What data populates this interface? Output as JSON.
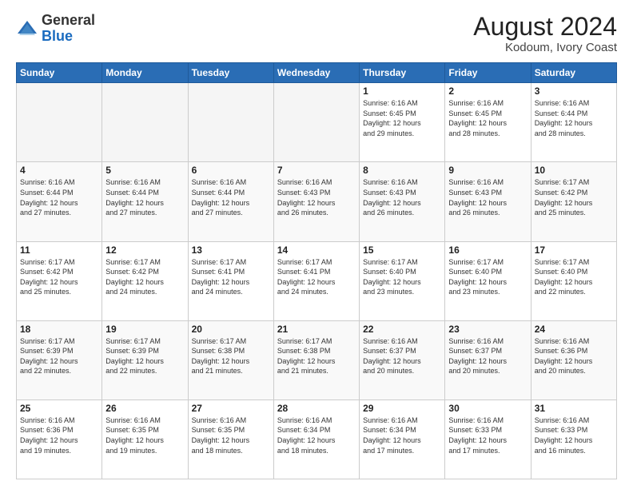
{
  "header": {
    "logo_general": "General",
    "logo_blue": "Blue",
    "month_year": "August 2024",
    "location": "Kodoum, Ivory Coast"
  },
  "days_of_week": [
    "Sunday",
    "Monday",
    "Tuesday",
    "Wednesday",
    "Thursday",
    "Friday",
    "Saturday"
  ],
  "weeks": [
    [
      {
        "day": "",
        "info": ""
      },
      {
        "day": "",
        "info": ""
      },
      {
        "day": "",
        "info": ""
      },
      {
        "day": "",
        "info": ""
      },
      {
        "day": "1",
        "info": "Sunrise: 6:16 AM\nSunset: 6:45 PM\nDaylight: 12 hours\nand 29 minutes."
      },
      {
        "day": "2",
        "info": "Sunrise: 6:16 AM\nSunset: 6:45 PM\nDaylight: 12 hours\nand 28 minutes."
      },
      {
        "day": "3",
        "info": "Sunrise: 6:16 AM\nSunset: 6:44 PM\nDaylight: 12 hours\nand 28 minutes."
      }
    ],
    [
      {
        "day": "4",
        "info": "Sunrise: 6:16 AM\nSunset: 6:44 PM\nDaylight: 12 hours\nand 27 minutes."
      },
      {
        "day": "5",
        "info": "Sunrise: 6:16 AM\nSunset: 6:44 PM\nDaylight: 12 hours\nand 27 minutes."
      },
      {
        "day": "6",
        "info": "Sunrise: 6:16 AM\nSunset: 6:44 PM\nDaylight: 12 hours\nand 27 minutes."
      },
      {
        "day": "7",
        "info": "Sunrise: 6:16 AM\nSunset: 6:43 PM\nDaylight: 12 hours\nand 26 minutes."
      },
      {
        "day": "8",
        "info": "Sunrise: 6:16 AM\nSunset: 6:43 PM\nDaylight: 12 hours\nand 26 minutes."
      },
      {
        "day": "9",
        "info": "Sunrise: 6:16 AM\nSunset: 6:43 PM\nDaylight: 12 hours\nand 26 minutes."
      },
      {
        "day": "10",
        "info": "Sunrise: 6:17 AM\nSunset: 6:42 PM\nDaylight: 12 hours\nand 25 minutes."
      }
    ],
    [
      {
        "day": "11",
        "info": "Sunrise: 6:17 AM\nSunset: 6:42 PM\nDaylight: 12 hours\nand 25 minutes."
      },
      {
        "day": "12",
        "info": "Sunrise: 6:17 AM\nSunset: 6:42 PM\nDaylight: 12 hours\nand 24 minutes."
      },
      {
        "day": "13",
        "info": "Sunrise: 6:17 AM\nSunset: 6:41 PM\nDaylight: 12 hours\nand 24 minutes."
      },
      {
        "day": "14",
        "info": "Sunrise: 6:17 AM\nSunset: 6:41 PM\nDaylight: 12 hours\nand 24 minutes."
      },
      {
        "day": "15",
        "info": "Sunrise: 6:17 AM\nSunset: 6:40 PM\nDaylight: 12 hours\nand 23 minutes."
      },
      {
        "day": "16",
        "info": "Sunrise: 6:17 AM\nSunset: 6:40 PM\nDaylight: 12 hours\nand 23 minutes."
      },
      {
        "day": "17",
        "info": "Sunrise: 6:17 AM\nSunset: 6:40 PM\nDaylight: 12 hours\nand 22 minutes."
      }
    ],
    [
      {
        "day": "18",
        "info": "Sunrise: 6:17 AM\nSunset: 6:39 PM\nDaylight: 12 hours\nand 22 minutes."
      },
      {
        "day": "19",
        "info": "Sunrise: 6:17 AM\nSunset: 6:39 PM\nDaylight: 12 hours\nand 22 minutes."
      },
      {
        "day": "20",
        "info": "Sunrise: 6:17 AM\nSunset: 6:38 PM\nDaylight: 12 hours\nand 21 minutes."
      },
      {
        "day": "21",
        "info": "Sunrise: 6:17 AM\nSunset: 6:38 PM\nDaylight: 12 hours\nand 21 minutes."
      },
      {
        "day": "22",
        "info": "Sunrise: 6:16 AM\nSunset: 6:37 PM\nDaylight: 12 hours\nand 20 minutes."
      },
      {
        "day": "23",
        "info": "Sunrise: 6:16 AM\nSunset: 6:37 PM\nDaylight: 12 hours\nand 20 minutes."
      },
      {
        "day": "24",
        "info": "Sunrise: 6:16 AM\nSunset: 6:36 PM\nDaylight: 12 hours\nand 20 minutes."
      }
    ],
    [
      {
        "day": "25",
        "info": "Sunrise: 6:16 AM\nSunset: 6:36 PM\nDaylight: 12 hours\nand 19 minutes."
      },
      {
        "day": "26",
        "info": "Sunrise: 6:16 AM\nSunset: 6:35 PM\nDaylight: 12 hours\nand 19 minutes."
      },
      {
        "day": "27",
        "info": "Sunrise: 6:16 AM\nSunset: 6:35 PM\nDaylight: 12 hours\nand 18 minutes."
      },
      {
        "day": "28",
        "info": "Sunrise: 6:16 AM\nSunset: 6:34 PM\nDaylight: 12 hours\nand 18 minutes."
      },
      {
        "day": "29",
        "info": "Sunrise: 6:16 AM\nSunset: 6:34 PM\nDaylight: 12 hours\nand 17 minutes."
      },
      {
        "day": "30",
        "info": "Sunrise: 6:16 AM\nSunset: 6:33 PM\nDaylight: 12 hours\nand 17 minutes."
      },
      {
        "day": "31",
        "info": "Sunrise: 6:16 AM\nSunset: 6:33 PM\nDaylight: 12 hours\nand 16 minutes."
      }
    ]
  ]
}
